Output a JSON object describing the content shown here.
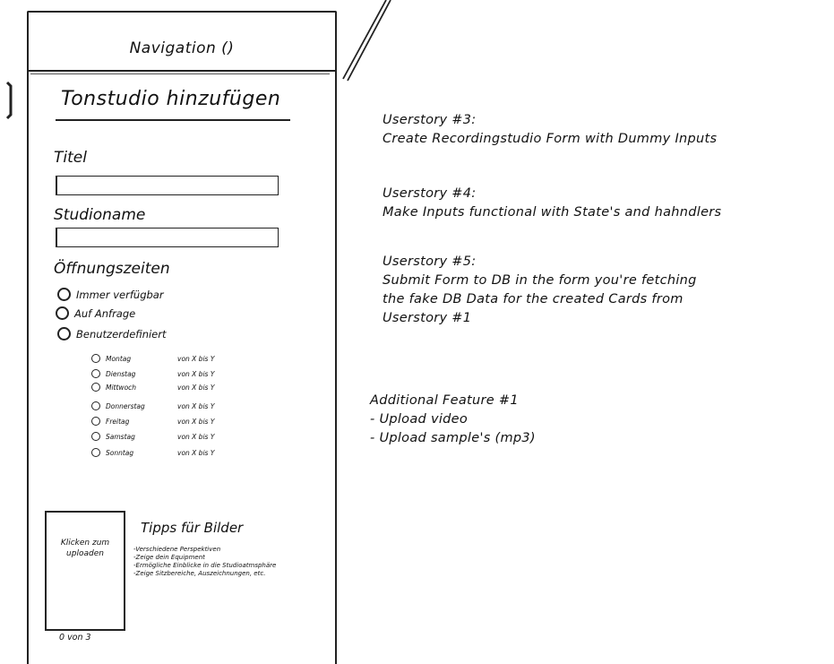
{
  "navigation": {
    "title": "Navigation ()"
  },
  "form": {
    "title": "Tonstudio hinzufügen",
    "fields": [
      {
        "label": "Titel",
        "value": ""
      },
      {
        "label": "Studioname",
        "value": ""
      }
    ],
    "opening_hours": {
      "label": "Öffnungszeiten",
      "options": [
        "Immer verfügbar",
        "Auf Anfrage",
        "Benutzerdefiniert"
      ],
      "days": [
        {
          "name": "Montag",
          "range": "von X bis Y"
        },
        {
          "name": "Dienstag",
          "range": "von X bis Y"
        },
        {
          "name": "Mittwoch",
          "range": "von X bis Y"
        },
        {
          "name": "Donnerstag",
          "range": "von X bis Y"
        },
        {
          "name": "Freitag",
          "range": "von X bis Y"
        },
        {
          "name": "Samstag",
          "range": "von X bis Y"
        },
        {
          "name": "Sonntag",
          "range": "von X bis Y"
        }
      ]
    },
    "upload": {
      "label_line1": "Klicken zum",
      "label_line2": "uploaden",
      "count": "0 von 3"
    },
    "tips": {
      "title": "Tipps für Bilder",
      "items": [
        "-Verschiedene Perspektiven",
        "-Zeige dein Equipment",
        "-Ermögliche Einblicke in die Studioatmsphäre",
        "-Zeige Sitzbereiche, Auszeichnungen, etc."
      ]
    }
  },
  "userstories": [
    {
      "title": "Userstory #3:",
      "lines": [
        "Create Recordingstudio Form with Dummy Inputs"
      ]
    },
    {
      "title": "Userstory #4:",
      "lines": [
        "Make Inputs functional with State's and hahndlers"
      ]
    },
    {
      "title": "Userstory #5:",
      "lines": [
        "Submit Form to DB in the form you're fetching",
        "the fake DB Data for the created Cards from",
        "Userstory #1"
      ]
    }
  ],
  "additional_feature": {
    "title": "Additional Feature #1",
    "items": [
      "- Upload video",
      "- Upload sample's (mp3)"
    ]
  }
}
